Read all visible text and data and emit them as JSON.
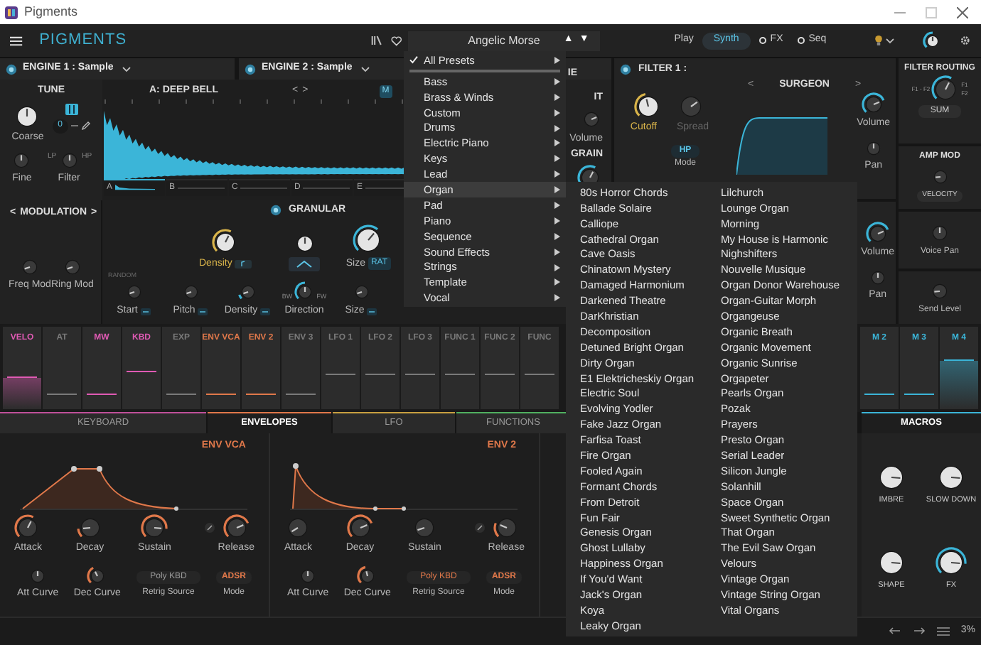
{
  "window": {
    "title": "Pigments"
  },
  "toolbar": {
    "logo": "PIGMENTS",
    "preset": "Angelic Morse",
    "up": "▲",
    "down": "▼",
    "modes": [
      {
        "label": "Play",
        "selected": false,
        "kind": "plain"
      },
      {
        "label": "Synth",
        "selected": true,
        "kind": "plain"
      },
      {
        "label": "FX",
        "selected": false,
        "kind": "dot"
      },
      {
        "label": "Seq",
        "selected": false,
        "kind": "dot"
      }
    ]
  },
  "engines": [
    {
      "title": "ENGINE 1 : Sample"
    },
    {
      "title": "ENGINE 2 : Sample"
    }
  ],
  "fragments": [
    "IE",
    "IT",
    "Volume",
    "GRAIN"
  ],
  "tune": {
    "title": "TUNE",
    "transpose": "0",
    "knobs": [
      {
        "label": "Coarse"
      },
      {
        "label": "Fine"
      },
      {
        "label": "Filter"
      }
    ],
    "filter_ends": [
      "LP",
      "HP"
    ]
  },
  "sample": {
    "name": "A: DEEP BELL",
    "prev": "<",
    "next": ">",
    "button": "M",
    "slots": [
      {
        "label": "A",
        "selected": true
      },
      {
        "label": "B",
        "selected": false
      },
      {
        "label": "C",
        "selected": false
      },
      {
        "label": "D",
        "selected": false
      },
      {
        "label": "E",
        "selected": false
      }
    ]
  },
  "modulation": {
    "title": "MODULATION",
    "prev": "<",
    "next": ">",
    "knobs": [
      {
        "label": "Freq Mod"
      },
      {
        "label": "Ring Mod"
      }
    ]
  },
  "granular": {
    "title": "GRANULAR",
    "random": "RANDOM",
    "knobs": [
      {
        "label": "Density"
      },
      {
        "label": "Size"
      }
    ],
    "size_tag": "RAT",
    "random_knobs": [
      {
        "label": "Start"
      },
      {
        "label": "Pitch"
      },
      {
        "label": "Density"
      },
      {
        "label": "Direction"
      },
      {
        "label": "Size"
      }
    ],
    "direction_ends": [
      "BW",
      "FW"
    ]
  },
  "filter1": {
    "title": "FILTER 1 :",
    "type": "SURGEON",
    "prev": "<",
    "next": ">",
    "knobs": [
      {
        "label": "Cutoff"
      },
      {
        "label": "Spread"
      }
    ],
    "mode": "HP",
    "mode_label": "Mode",
    "out": [
      {
        "label": "Volume"
      },
      {
        "label": "Pan"
      }
    ]
  },
  "filter2": {
    "out": [
      {
        "label": "Volume"
      },
      {
        "label": "Pan"
      }
    ]
  },
  "routing": {
    "title": "FILTER ROUTING",
    "left": "F1 - F2",
    "right_top": "F1",
    "right_bottom": "F2",
    "value": "SUM"
  },
  "amp_mod": {
    "title": "AMP MOD",
    "value": "VELOCITY"
  },
  "voice": [
    {
      "label": "Voice Pan"
    },
    {
      "label": "Send Level"
    }
  ],
  "mod_sources": [
    {
      "label": "VELO",
      "color": "#e05ab4",
      "filled": true
    },
    {
      "label": "AT",
      "color": "#7a7a7a",
      "filled": false
    },
    {
      "label": "MW",
      "color": "#e05ab4",
      "filled": false
    },
    {
      "label": "KBD",
      "color": "#e05ab4",
      "filled": false
    },
    {
      "label": "EXP",
      "color": "#7a7a7a",
      "filled": false
    },
    {
      "label": "ENV VCA",
      "color": "#e0784a",
      "filled": false
    },
    {
      "label": "ENV 2",
      "color": "#e0784a",
      "filled": false
    },
    {
      "label": "ENV 3",
      "color": "#7a7a7a",
      "filled": false
    },
    {
      "label": "LFO 1",
      "color": "#7a7a7a",
      "filled": false
    },
    {
      "label": "LFO 2",
      "color": "#7a7a7a",
      "filled": false
    },
    {
      "label": "LFO 3",
      "color": "#7a7a7a",
      "filled": false
    },
    {
      "label": "FUNC 1",
      "color": "#7a7a7a",
      "filled": false
    },
    {
      "label": "FUNC 2",
      "color": "#7a7a7a",
      "filled": false
    },
    {
      "label": "FUNC",
      "color": "#7a7a7a",
      "filled": false
    }
  ],
  "macro_sources": [
    {
      "label": "M 2",
      "color": "#3bb5d8",
      "filled": false
    },
    {
      "label": "M 3",
      "color": "#3bb5d8",
      "filled": false
    },
    {
      "label": "M 4",
      "color": "#3bb5d8",
      "filled": true
    }
  ],
  "tabs": [
    {
      "label": "KEYBOARD",
      "color": "#c0509a",
      "selected": false
    },
    {
      "label": "ENVELOPES",
      "color": "#e0784a",
      "selected": true
    },
    {
      "label": "LFO",
      "color": "#c8a040",
      "selected": false
    },
    {
      "label": "FUNCTIONS",
      "color": "#50b060",
      "selected": false
    }
  ],
  "macros_tab": {
    "label": "MACROS",
    "color": "#3bb5d8"
  },
  "envelopes": [
    {
      "title": "ENV VCA",
      "kind": "plateau",
      "knobs": [
        {
          "label": "Attack"
        },
        {
          "label": "Decay"
        },
        {
          "label": "Sustain"
        },
        {
          "label": "Release"
        }
      ],
      "curves": [
        {
          "label": "Att Curve"
        },
        {
          "label": "Dec Curve"
        }
      ],
      "retrig": {
        "value": "Poly KBD",
        "label": "Retrig Source",
        "active": false
      },
      "mode": {
        "value": "ADSR",
        "label": "Mode"
      }
    },
    {
      "title": "ENV 2",
      "kind": "spike",
      "knobs": [
        {
          "label": "Attack"
        },
        {
          "label": "Decay"
        },
        {
          "label": "Sustain"
        },
        {
          "label": "Release"
        }
      ],
      "curves": [
        {
          "label": "Att Curve"
        },
        {
          "label": "Dec Curve"
        }
      ],
      "retrig": {
        "value": "Poly KBD",
        "label": "Retrig Source",
        "active": true
      },
      "mode": {
        "value": "ADSR",
        "label": "Mode"
      }
    }
  ],
  "macros": [
    {
      "label": "IMBRE"
    },
    {
      "label": "SLOW DOWN"
    },
    {
      "label": "SHAPE"
    },
    {
      "label": "FX"
    }
  ],
  "status_bar": {
    "zoom": "3%"
  },
  "menu": {
    "items": [
      {
        "label": "All Presets",
        "checked": true,
        "selected": false
      },
      {
        "label": "Bass",
        "checked": false,
        "selected": false
      },
      {
        "label": "Brass & Winds",
        "checked": false,
        "selected": false
      },
      {
        "label": "Custom",
        "checked": false,
        "selected": false
      },
      {
        "label": "Drums",
        "checked": false,
        "selected": false
      },
      {
        "label": "Electric Piano",
        "checked": false,
        "selected": false
      },
      {
        "label": "Keys",
        "checked": false,
        "selected": false
      },
      {
        "label": "Lead",
        "checked": false,
        "selected": false
      },
      {
        "label": "Organ",
        "checked": false,
        "selected": true
      },
      {
        "label": "Pad",
        "checked": false,
        "selected": false
      },
      {
        "label": "Piano",
        "checked": false,
        "selected": false
      },
      {
        "label": "Sequence",
        "checked": false,
        "selected": false
      },
      {
        "label": "Sound Effects",
        "checked": false,
        "selected": false
      },
      {
        "label": "Strings",
        "checked": false,
        "selected": false
      },
      {
        "label": "Template",
        "checked": false,
        "selected": false
      },
      {
        "label": "Vocal",
        "checked": false,
        "selected": false
      }
    ],
    "submenu": [
      [
        "80s Horror Chords",
        "Ballade Solaire",
        "Calliope",
        "Cathedral Organ",
        "Cave Oasis",
        "Chinatown Mystery",
        "Damaged Harmonium",
        "Darkened Theatre",
        "DarKhristian",
        "Decomposition",
        "Detuned Bright Organ",
        "Dirty Organ",
        "E1 Elektricheskiy Organ",
        "Electric Soul",
        "Evolving Yodler",
        "Fake Jazz Organ",
        "Farfisa Toast",
        "Fire Organ",
        "Fooled Again",
        "Formant Chords",
        "From Detroit",
        "Fun Fair",
        "Genesis Organ",
        "Ghost Lullaby",
        "Happiness Organ",
        "If You'd Want",
        "Jack's Organ",
        "Koya",
        "Leaky Organ"
      ],
      [
        "Lilchurch",
        "Lounge Organ",
        "Morning",
        "My House is Harmonic",
        "Nighshifters",
        "Nouvelle Musique",
        "Organ Donor Warehouse",
        "Organ-Guitar Morph",
        "Organgeuse",
        "Organic Breath",
        "Organic Movement",
        "Organic Sunrise",
        "Orgapeter",
        "Pearls Organ",
        "Pozak",
        "Prayers",
        "Presto Organ",
        "Serial Leader",
        "Silicon Jungle",
        "Solanhill",
        "Space Organ",
        "Sweet Synthetic Organ",
        "That Organ",
        "The Evil Saw Organ",
        "Velours",
        "Vintage Organ",
        "Vintage String Organ",
        "Vital Organs"
      ]
    ]
  }
}
